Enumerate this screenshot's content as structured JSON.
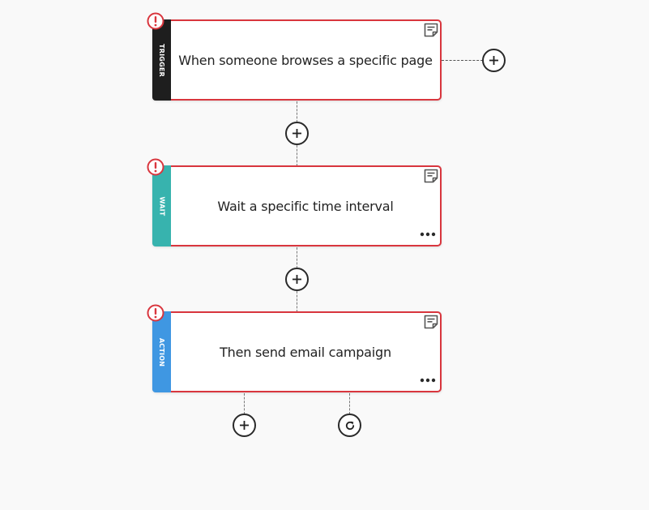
{
  "workflow": {
    "trigger": {
      "tag": "TRIGGER",
      "title": "When someone browses a specific page",
      "stripe_color": "#1e1e1e",
      "status": "error"
    },
    "wait": {
      "tag": "WAIT",
      "title": "Wait a specific time interval",
      "stripe_color": "#37b3ae",
      "status": "error"
    },
    "action": {
      "tag": "ACTION",
      "title": "Then send email campaign",
      "stripe_color": "#3f97e2",
      "status": "error"
    }
  },
  "colors": {
    "error_border": "#d9363e",
    "background": "#f9f9f9"
  },
  "icons": {
    "note": "note-icon",
    "more": "more-options-icon",
    "error": "error-exclamation-icon",
    "add": "plus-icon",
    "loop": "loop-refresh-icon"
  }
}
